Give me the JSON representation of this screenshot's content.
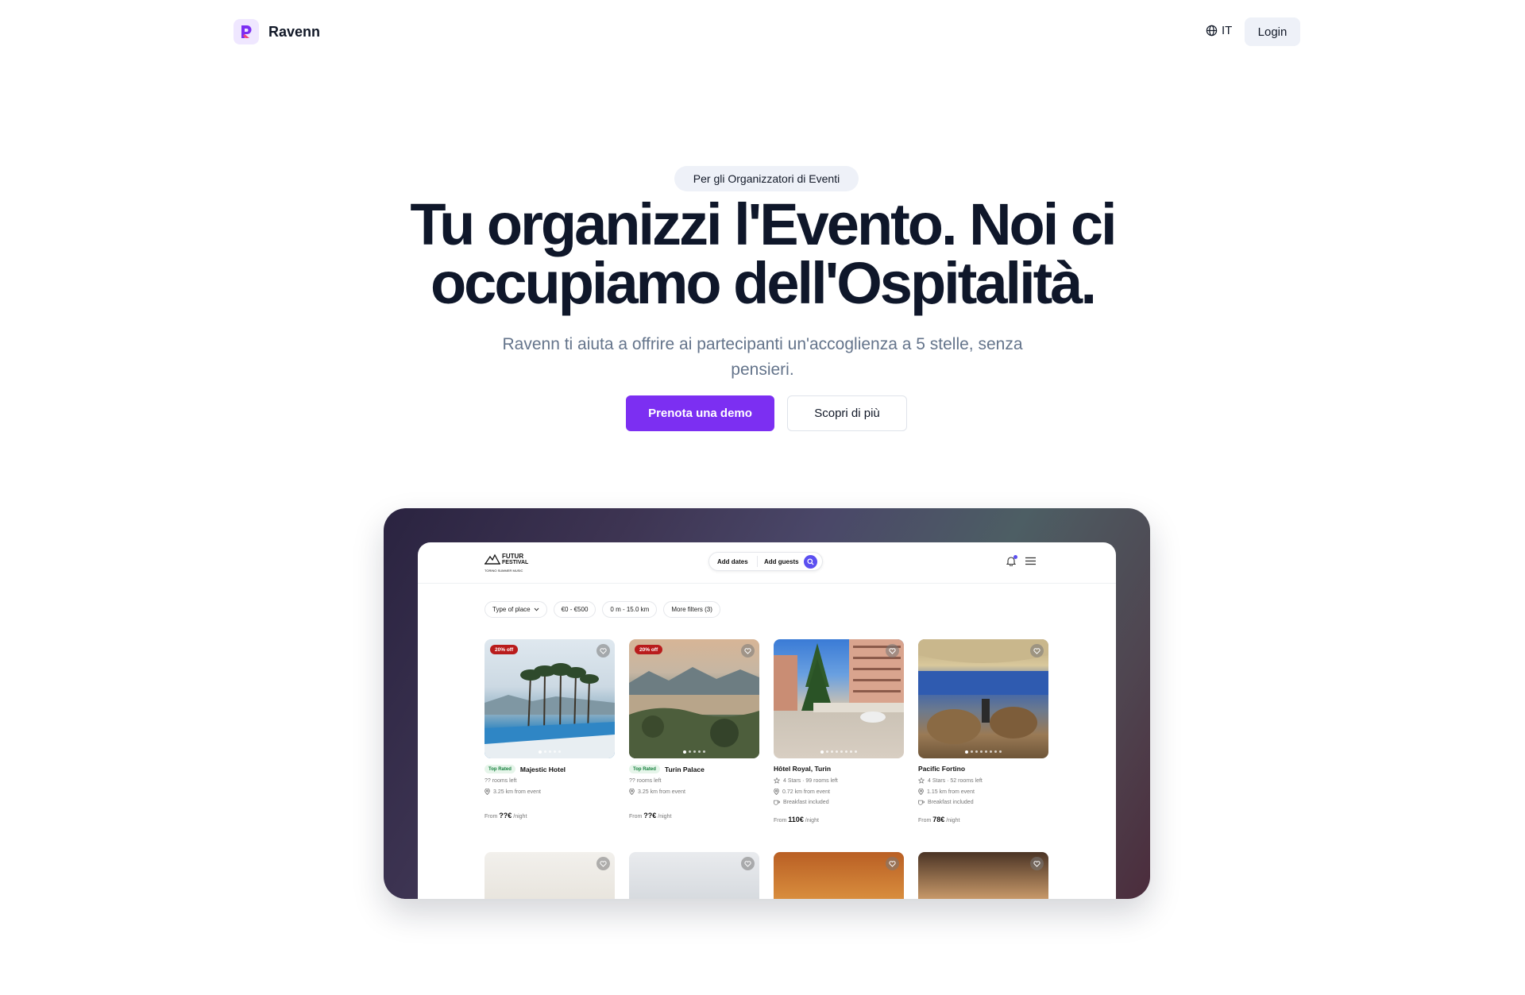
{
  "nav": {
    "brand_name": "Ravenn",
    "language": "IT",
    "login_label": "Login"
  },
  "hero": {
    "badge": "Per gli Organizzatori di Eventi",
    "title": "Tu organizzi l'Evento. Noi ci occupiamo dell'Ospitalità.",
    "subtitle": "Ravenn ti aiuta a offrire ai partecipanti un'accoglienza a 5 stelle, senza pensieri.",
    "primary_cta": "Prenota una demo",
    "secondary_cta": "Scopri di più"
  },
  "showcase": {
    "event_logo": {
      "line1": "FUTUR",
      "line2": "FESTIVAL",
      "line3": "TORINO SUMMER MUSIC"
    },
    "search": {
      "dates": "Add dates",
      "guests": "Add guests"
    },
    "filters": [
      "Type of place",
      "€0 - €500",
      "0 m - 15.0 km",
      "More filters (3)"
    ],
    "cards": [
      {
        "discount": "20% off",
        "badge": "Top Rated",
        "name": "Majestic Hotel",
        "line1": "?? rooms left",
        "line2": "3.25 km from event",
        "line3": "",
        "price_prefix": "From",
        "price": "??€",
        "price_suffix": "/night"
      },
      {
        "discount": "20% off",
        "badge": "Top Rated",
        "name": "Turin Palace",
        "line1": "?? rooms left",
        "line2": "3.25 km from event",
        "line3": "",
        "price_prefix": "From",
        "price": "??€",
        "price_suffix": "/night"
      },
      {
        "discount": "",
        "badge": "",
        "name": "Hôtel Royal, Turin",
        "line1": "4 Stars · 99 rooms left",
        "line2": "0.72 km from event",
        "line3": "Breakfast included",
        "price_prefix": "From",
        "price": "110€",
        "price_suffix": "/night"
      },
      {
        "discount": "",
        "badge": "",
        "name": "Pacific Fortino",
        "line1": "4 Stars · 52 rooms left",
        "line2": "1.15 km from event",
        "line3": "Breakfast included",
        "price_prefix": "From",
        "price": "78€",
        "price_suffix": "/night"
      }
    ],
    "colors": {
      "accent": "#7c2ff2",
      "search_button": "#5b4ff0",
      "discount_badge": "#b91c1c",
      "top_rated_badge": "#15803d"
    }
  }
}
